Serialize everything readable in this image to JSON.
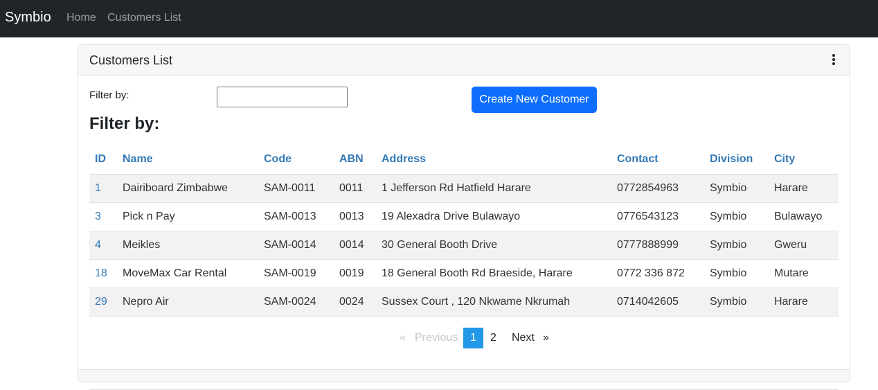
{
  "navbar": {
    "brand": "Symbio",
    "links": [
      "Home",
      "Customers List"
    ]
  },
  "card": {
    "title": "Customers List",
    "menu_icon": "kebab-vertical-icon"
  },
  "filter": {
    "label": "Filter by:",
    "value": "",
    "heading": "Filter by:"
  },
  "actions": {
    "create_label": "Create New Customer"
  },
  "table": {
    "columns": [
      "ID",
      "Name",
      "Code",
      "ABN",
      "Address",
      "Contact",
      "Division",
      "City"
    ],
    "rows": [
      [
        "1",
        "Dairiboard Zimbabwe",
        "SAM-0011",
        "0011",
        "1 Jefferson Rd Hatfield Harare",
        "0772854963",
        "Symbio",
        "Harare"
      ],
      [
        "3",
        "Pick n Pay",
        "SAM-0013",
        "0013",
        "19 Alexadra Drive Bulawayo",
        "0776543123",
        "Symbio",
        "Bulawayo"
      ],
      [
        "4",
        "Meikles",
        "SAM-0014",
        "0014",
        "30 General Booth Drive",
        "0777888999",
        "Symbio",
        "Gweru"
      ],
      [
        "18",
        "MoveMax Car Rental",
        "SAM-0019",
        "0019",
        "18 General Booth Rd Braeside, Harare",
        "0772 336 872",
        "Symbio",
        "Mutare"
      ],
      [
        "29",
        "Nepro Air",
        "SAM-0024",
        "0024",
        "Sussex Court , 120 Nkwame Nkrumah",
        "0714042605",
        "Symbio",
        "Harare"
      ]
    ]
  },
  "pagination": {
    "prev_arrow": "«",
    "prev_label": "Previous",
    "pages": [
      "1",
      "2"
    ],
    "current": "1",
    "next_label": "Next",
    "next_arrow": "»"
  },
  "colors": {
    "navbar_bg": "#212529",
    "accent": "#0d6efd",
    "link": "#337ab7",
    "active_page": "#2199e8"
  }
}
